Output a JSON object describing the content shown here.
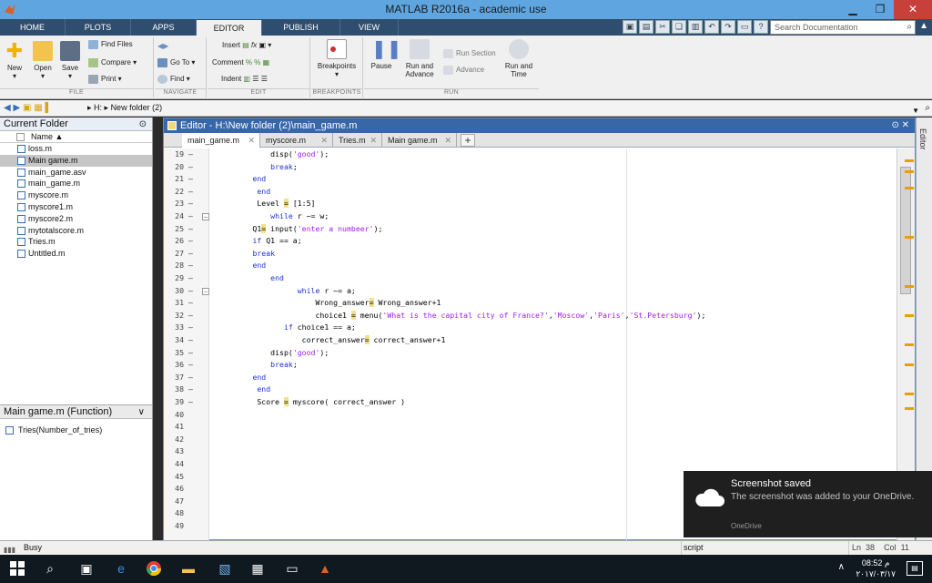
{
  "window": {
    "title": "MATLAB R2016a - academic use"
  },
  "ribbon_tabs": [
    "HOME",
    "PLOTS",
    "APPS",
    "EDITOR",
    "PUBLISH",
    "VIEW"
  ],
  "search": {
    "placeholder": "Search Documentation"
  },
  "ribbon": {
    "file": {
      "new": "New",
      "open": "Open",
      "save": "Save",
      "find_files": "Find Files",
      "compare": "Compare",
      "print": "Print",
      "section": "FILE"
    },
    "navigate": {
      "go_to": "Go To",
      "find": "Find",
      "section": "NAVIGATE"
    },
    "edit": {
      "insert": "Insert",
      "comment": "Comment",
      "indent": "Indent",
      "section": "EDIT"
    },
    "breakpoints": {
      "label": "Breakpoints",
      "section": "BREAKPOINTS"
    },
    "run": {
      "pause": "Pause",
      "run_advance_1": "Run and",
      "run_advance_2": "Advance",
      "run_section": "Run Section",
      "advance": "Advance",
      "run_time_1": "Run and",
      "run_time_2": "Time",
      "section": "RUN"
    }
  },
  "address": {
    "drive": "H:",
    "folder": "New folder (2)"
  },
  "current_folder": {
    "title": "Current Folder",
    "col_name": "Name ▲",
    "files": [
      "loss.m",
      "Main game.m",
      "main_game.asv",
      "main_game.m",
      "myscore.m",
      "myscore1.m",
      "myscore2.m",
      "mytotalscore.m",
      "Tries.m",
      "Untitled.m"
    ],
    "selected_index": 1
  },
  "details": {
    "title": "Main game.m  (Function)",
    "item": "Tries(Number_of_tries)"
  },
  "editor": {
    "title": "Editor - H:\\New folder (2)\\main_game.m",
    "tabs": [
      "main_game.m",
      "myscore.m",
      "Tries.m",
      "Main game.m"
    ],
    "active_tab": 0,
    "lines": [
      {
        "n": "19",
        "code": "            disp('good');"
      },
      {
        "n": "20",
        "code": "            break;"
      },
      {
        "n": "21",
        "code": "        end"
      },
      {
        "n": "22",
        "code": "         end"
      },
      {
        "n": "23",
        "code": "         Level = [1:5]"
      },
      {
        "n": "24",
        "code": "            while r ~= w;"
      },
      {
        "n": "25",
        "code": "        Q1= input('enter a numbeer');"
      },
      {
        "n": "26",
        "code": "        if Q1 == a;"
      },
      {
        "n": "27",
        "code": "        break"
      },
      {
        "n": "28",
        "code": "        end"
      },
      {
        "n": "29",
        "code": "            end"
      },
      {
        "n": "30",
        "code": "                  while r ~= a;"
      },
      {
        "n": "31",
        "code": "                      Wrong_answer= Wrong_answer+1"
      },
      {
        "n": "32",
        "code": "                      choice1 = menu('What is the capital city of France?','Moscow','Paris','St.Petersburg');"
      },
      {
        "n": "33",
        "code": "               if choice1 == a;"
      },
      {
        "n": "34",
        "code": "                   correct_answer= correct_answer+1"
      },
      {
        "n": "35",
        "code": "            disp('good');"
      },
      {
        "n": "36",
        "code": "            break;"
      },
      {
        "n": "37",
        "code": "        end"
      },
      {
        "n": "38",
        "code": "         end"
      },
      {
        "n": "39",
        "code": "         Score = myscore( correct_answer )"
      },
      {
        "n": "40",
        "code": ""
      },
      {
        "n": "41",
        "code": ""
      },
      {
        "n": "42",
        "code": ""
      },
      {
        "n": "43",
        "code": ""
      },
      {
        "n": "44",
        "code": ""
      },
      {
        "n": "45",
        "code": ""
      },
      {
        "n": "46",
        "code": ""
      },
      {
        "n": "47",
        "code": ""
      },
      {
        "n": "48",
        "code": ""
      },
      {
        "n": "49",
        "code": ""
      }
    ]
  },
  "side_label": "Editor",
  "toast": {
    "title": "Screenshot saved",
    "body": "The screenshot was added to your OneDrive.",
    "source": "OneDrive"
  },
  "status": {
    "state": "Busy",
    "mode": "script",
    "ln_label": "Ln",
    "ln": "38",
    "col_label": "Col",
    "col": "11"
  },
  "clock": {
    "time": "08:52 م",
    "date": "٢٠١٧/٠٣/١٧"
  },
  "colors": {
    "title_bar": "#5fa6e0",
    "tab_bar": "#2f4d6e",
    "editor_header": "#3867a8",
    "keyword": "#1f34d0",
    "string": "#a020f0"
  }
}
